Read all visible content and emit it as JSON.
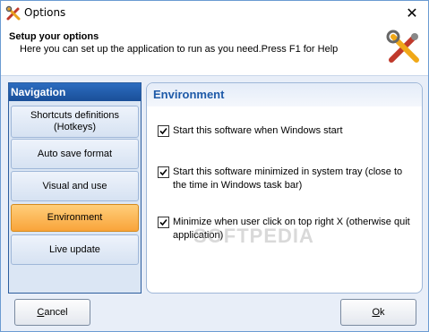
{
  "window": {
    "title": "Options",
    "close_glyph": "✕"
  },
  "header": {
    "title": "Setup your options",
    "subtitle": "Here you can set up the application to run as you need.Press F1 for Help",
    "icon": "tools-icon"
  },
  "navigation": {
    "title": "Navigation",
    "items": [
      {
        "label": "Shortcuts definitions\n(Hotkeys)",
        "active": false
      },
      {
        "label": "Auto save format",
        "active": false
      },
      {
        "label": "Visual and use",
        "active": false
      },
      {
        "label": "Environment",
        "active": true
      },
      {
        "label": "Live update",
        "active": false
      }
    ]
  },
  "content": {
    "title": "Environment",
    "options": [
      {
        "label": "Start this software when Windows start",
        "checked": true
      },
      {
        "label": "Start this software minimized in system tray (close to the time in Windows task bar)",
        "checked": true
      },
      {
        "label": "Minimize when user click on top right X (otherwise quit application)",
        "checked": true
      }
    ]
  },
  "buttons": {
    "cancel_first": "C",
    "cancel_rest": "ancel",
    "ok_first": "O",
    "ok_rest": "k"
  },
  "watermark": "SOFTPEDIA",
  "colors": {
    "accent": "#1e5aa8",
    "active_item": "#f9a43a"
  }
}
